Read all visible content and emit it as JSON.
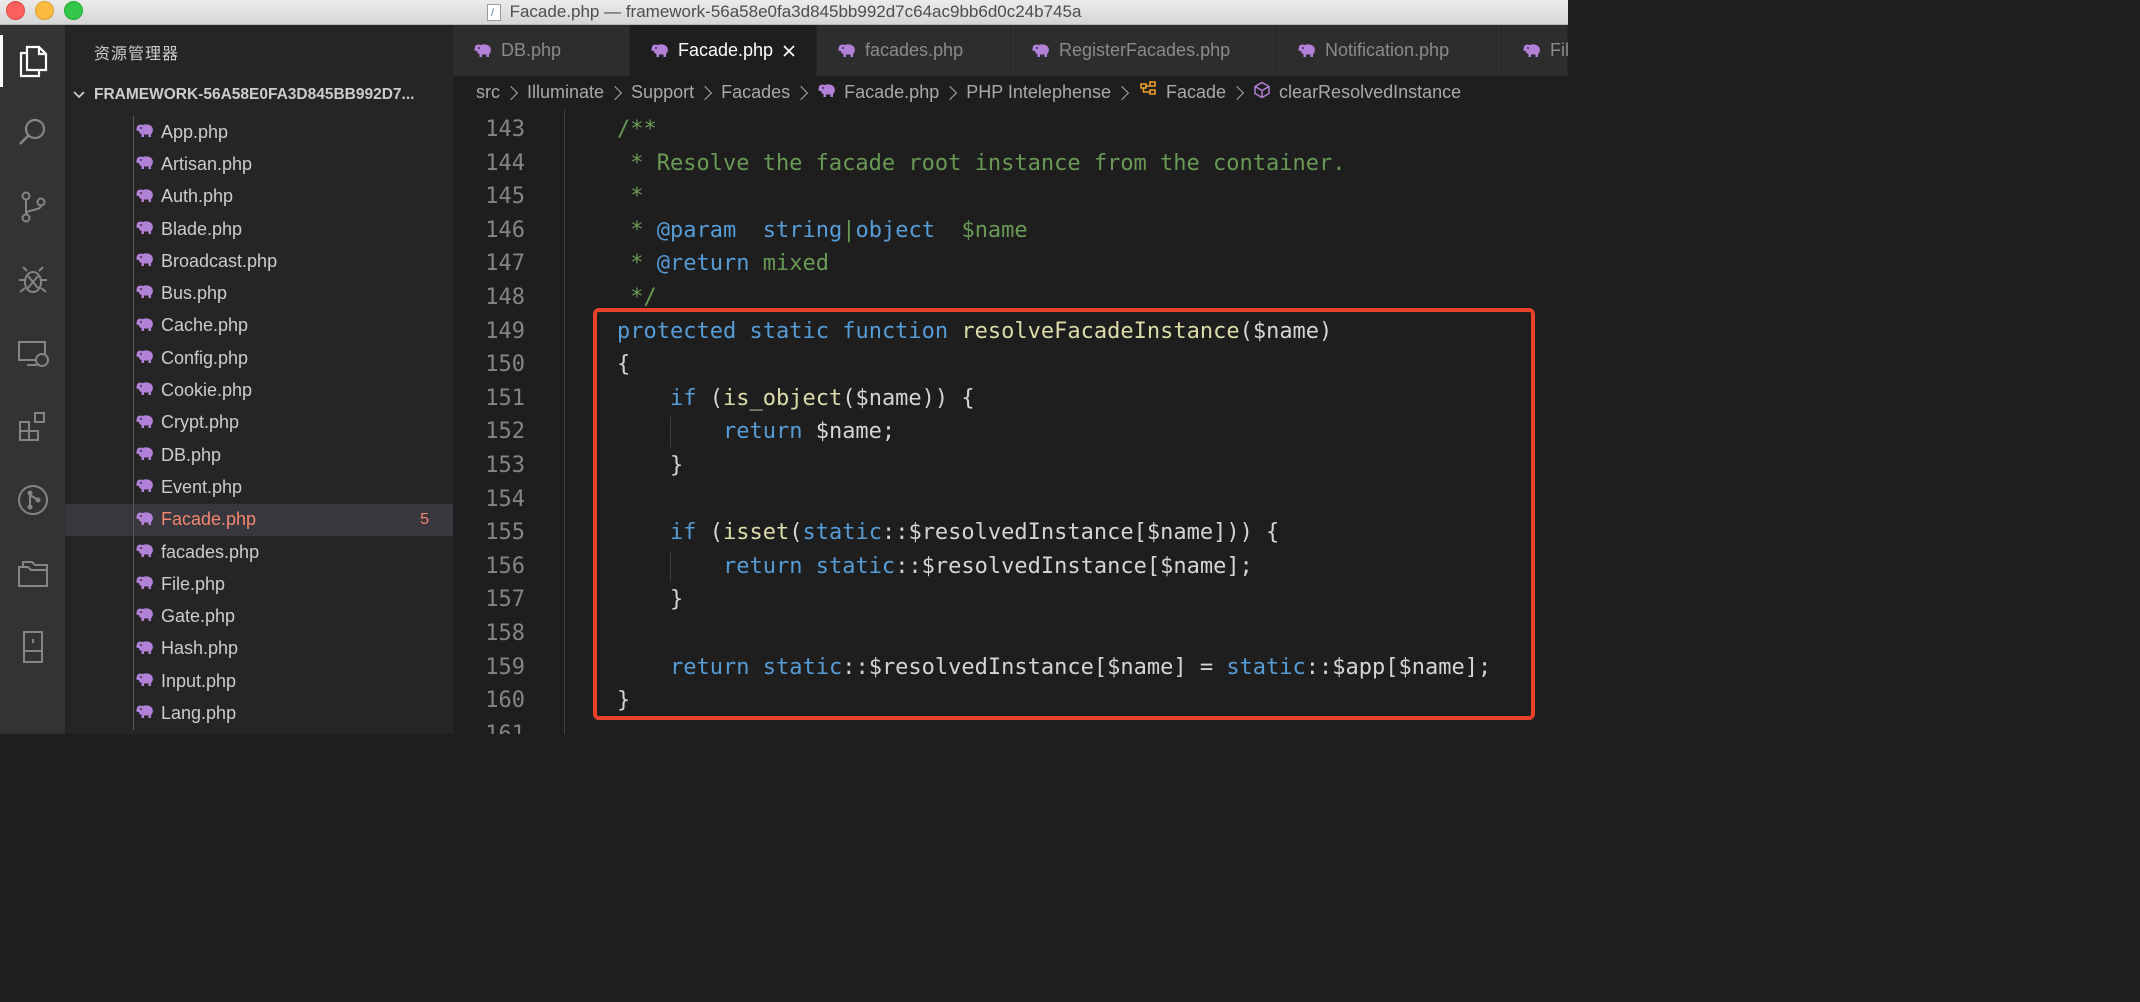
{
  "window": {
    "title": "Facade.php — framework-56a58e0fa3d845bb992d7c64ac9bb6d0c24b745a"
  },
  "sidebar": {
    "title": "资源管理器",
    "section_label": "FRAMEWORK-56A58E0FA3D845BB992D7...",
    "files": [
      {
        "name": "App.php"
      },
      {
        "name": "Artisan.php"
      },
      {
        "name": "Auth.php"
      },
      {
        "name": "Blade.php"
      },
      {
        "name": "Broadcast.php"
      },
      {
        "name": "Bus.php"
      },
      {
        "name": "Cache.php"
      },
      {
        "name": "Config.php"
      },
      {
        "name": "Cookie.php"
      },
      {
        "name": "Crypt.php"
      },
      {
        "name": "DB.php"
      },
      {
        "name": "Event.php"
      },
      {
        "name": "Facade.php",
        "badge": "5",
        "active": true
      },
      {
        "name": "facades.php"
      },
      {
        "name": "File.php"
      },
      {
        "name": "Gate.php"
      },
      {
        "name": "Hash.php"
      },
      {
        "name": "Input.php"
      },
      {
        "name": "Lang.php"
      }
    ]
  },
  "tabs": [
    {
      "label": "DB.php"
    },
    {
      "label": "Facade.php",
      "active": true
    },
    {
      "label": "facades.php"
    },
    {
      "label": "RegisterFacades.php"
    },
    {
      "label": "Notification.php"
    },
    {
      "label": "Fil"
    }
  ],
  "breadcrumbs": {
    "items": [
      "src",
      "Illuminate",
      "Support",
      "Facades",
      "Facade.php",
      "PHP Intelephense",
      "Facade",
      "clearResolvedInstance"
    ]
  },
  "editor": {
    "line_numbers": [
      "143",
      "144",
      "145",
      "146",
      "147",
      "148",
      "149",
      "150",
      "151",
      "152",
      "153",
      "154",
      "155",
      "156",
      "157",
      "158",
      "159",
      "160",
      "161"
    ],
    "lines": [
      "/**",
      " * Resolve the facade root instance from the container.",
      " *",
      " * @param  string|object  $name",
      " * @return mixed",
      " */",
      "protected static function resolveFacadeInstance($name)",
      "{",
      "    if (is_object($name)) {",
      "        return $name;",
      "    }",
      "",
      "    if (isset(static::$resolvedInstance[$name])) {",
      "        return static::$resolvedInstance[$name];",
      "    }",
      "",
      "    return static::$resolvedInstance[$name] = static::$app[$name];",
      "}",
      ""
    ]
  },
  "colors": {
    "accent_highlight": "#e8412c",
    "php_icon": "#b180d7",
    "error_badge": "#f48771"
  }
}
